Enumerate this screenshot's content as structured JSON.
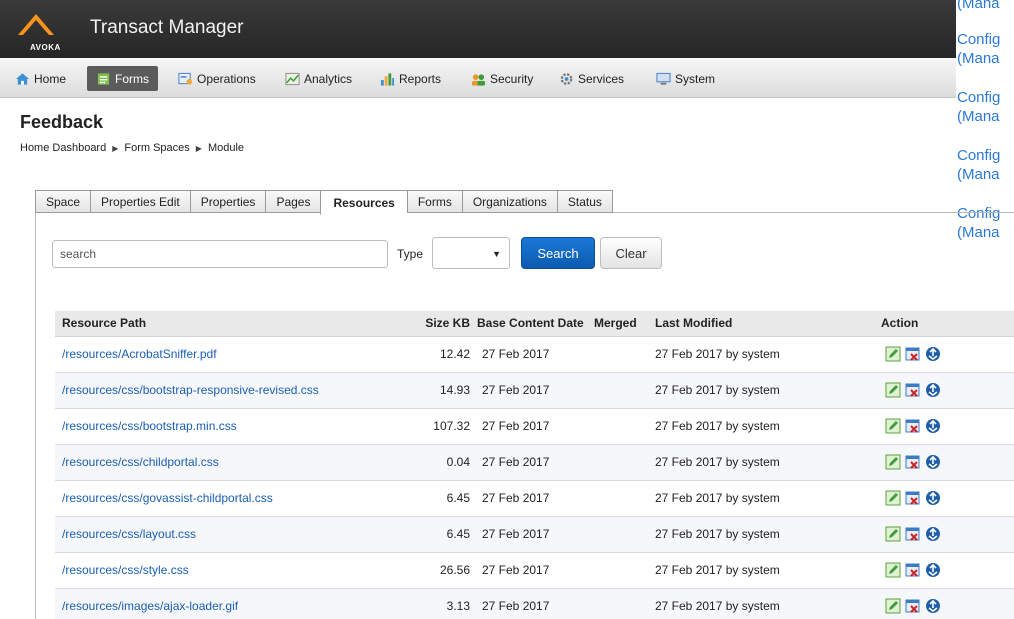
{
  "header": {
    "brand_word": "AVOKA",
    "app_title": "Transact Manager"
  },
  "side_links": {
    "top_fragment": "(Mana",
    "items": [
      {
        "line1": "Config",
        "line2": "(Mana"
      },
      {
        "line1": "Config",
        "line2": "(Mana"
      },
      {
        "line1": "Config",
        "line2": "(Mana"
      },
      {
        "line1": "Config",
        "line2": "(Mana"
      }
    ]
  },
  "nav": {
    "items": [
      {
        "label": "Home",
        "icon": "home-icon"
      },
      {
        "label": "Forms",
        "icon": "forms-icon",
        "active": true
      },
      {
        "label": "Operations",
        "icon": "operations-icon"
      },
      {
        "label": "Analytics",
        "icon": "analytics-icon"
      },
      {
        "label": "Reports",
        "icon": "reports-icon"
      },
      {
        "label": "Security",
        "icon": "security-icon"
      },
      {
        "label": "Services",
        "icon": "services-icon"
      },
      {
        "label": "System",
        "icon": "system-icon"
      }
    ]
  },
  "page": {
    "title": "Feedback",
    "breadcrumb": [
      "Home Dashboard",
      "Form Spaces",
      "Module"
    ]
  },
  "tabs": [
    "Space",
    "Properties Edit",
    "Properties",
    "Pages",
    "Resources",
    "Forms",
    "Organizations",
    "Status"
  ],
  "active_tab": "Resources",
  "search": {
    "placeholder": "search",
    "type_label": "Type",
    "type_value": "",
    "search_button": "Search",
    "clear_button": "Clear"
  },
  "table": {
    "headers": {
      "path": "Resource Path",
      "size": "Size KB",
      "base": "Base Content Date",
      "merged": "Merged",
      "modified": "Last Modified",
      "action": "Action"
    },
    "rows": [
      {
        "path": "/resources/AcrobatSniffer.pdf",
        "size": "12.42",
        "base": "27 Feb 2017",
        "merged": "",
        "modified": "27 Feb 2017 by system"
      },
      {
        "path": "/resources/css/bootstrap-responsive-revised.css",
        "size": "14.93",
        "base": "27 Feb 2017",
        "merged": "",
        "modified": "27 Feb 2017 by system"
      },
      {
        "path": "/resources/css/bootstrap.min.css",
        "size": "107.32",
        "base": "27 Feb 2017",
        "merged": "",
        "modified": "27 Feb 2017 by system"
      },
      {
        "path": "/resources/css/childportal.css",
        "size": "0.04",
        "base": "27 Feb 2017",
        "merged": "",
        "modified": "27 Feb 2017 by system"
      },
      {
        "path": "/resources/css/govassist-childportal.css",
        "size": "6.45",
        "base": "27 Feb 2017",
        "merged": "",
        "modified": "27 Feb 2017 by system"
      },
      {
        "path": "/resources/css/layout.css",
        "size": "6.45",
        "base": "27 Feb 2017",
        "merged": "",
        "modified": "27 Feb 2017 by system"
      },
      {
        "path": "/resources/css/style.css",
        "size": "26.56",
        "base": "27 Feb 2017",
        "merged": "",
        "modified": "27 Feb 2017 by system"
      },
      {
        "path": "/resources/images/ajax-loader.gif",
        "size": "3.13",
        "base": "27 Feb 2017",
        "merged": "",
        "modified": "27 Feb 2017 by system"
      }
    ],
    "action_icons": [
      "edit-icon",
      "delete-icon",
      "download-icon"
    ]
  },
  "colors": {
    "header_bg": "#2e2e2e",
    "brand_orange": "#f7941d",
    "link_blue": "#1a5fb4",
    "primary_button": "#1469c4"
  }
}
